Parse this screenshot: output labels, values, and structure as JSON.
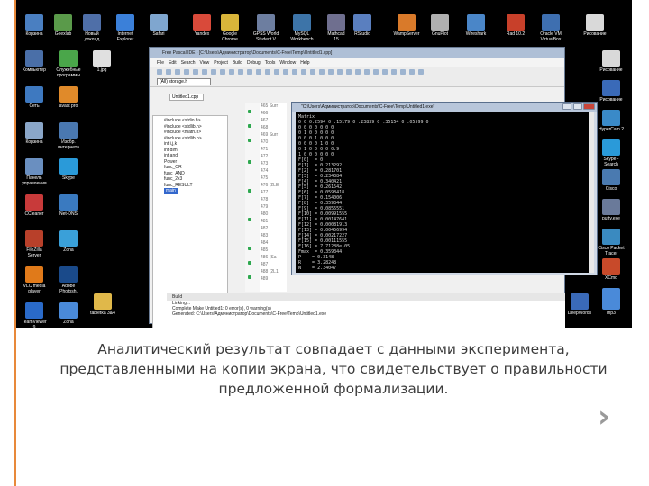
{
  "desktop": {
    "icons_top_row": [
      {
        "label": "Корзина",
        "color": "#4a7fc1"
      },
      {
        "label": "Geexlab",
        "color": "#5a9a4a"
      },
      {
        "label": "Новый\nдоклад",
        "color": "#4f6fa8"
      },
      {
        "label": "Internet\nExplorer",
        "color": "#3b80d9"
      },
      {
        "label": "Safari",
        "color": "#7fa6cf"
      },
      {
        "label": "Yandex",
        "color": "#d94a3a"
      },
      {
        "label": "Google\nChrome",
        "color": "#d9b53a"
      },
      {
        "label": "GPSS World\nStudent V",
        "color": "#6d7ea0"
      },
      {
        "label": "MySQL\nWorkbench",
        "color": "#3d74a8"
      },
      {
        "label": "Mathcad\n15",
        "color": "#6f6f8f"
      },
      {
        "label": "RStudio",
        "color": "#5a7fbf"
      },
      {
        "label": "WampServer",
        "color": "#d97a2a"
      },
      {
        "label": "GnuPlot",
        "color": "#b0b0b0"
      },
      {
        "label": "Wireshark",
        "color": "#4a86c8"
      },
      {
        "label": "Rad 10.2",
        "color": "#c8402a"
      },
      {
        "label": "Oracle VM\nVirtualBox",
        "color": "#3e6fb0"
      },
      {
        "label": "Рисование",
        "color": "#d9d9d9"
      }
    ],
    "icons_left_col": [
      {
        "label": "Компьютер",
        "color": "#4a6fa8"
      },
      {
        "label": "Сеть",
        "color": "#3e79c0"
      },
      {
        "label": "Корзина",
        "color": "#8aa6c8"
      },
      {
        "label": "Панель\nуправления",
        "color": "#6a8fc0"
      },
      {
        "label": "CCleaner",
        "color": "#c83a3a"
      },
      {
        "label": "FileZilla\nServer",
        "color": "#b8402a"
      },
      {
        "label": "VLC media\nplayer",
        "color": "#e07a1a"
      },
      {
        "label": "TeamViewer\n9",
        "color": "#2a6ac8"
      }
    ],
    "icons_second_col": [
      {
        "label": "Служебные\nпрограммы",
        "color": "#4aa64a"
      },
      {
        "label": "avast pro",
        "color": "#e08a2a"
      },
      {
        "label": "Изобр.\nинтернета",
        "color": "#4a78b0"
      },
      {
        "label": "Skype",
        "color": "#2a9ad9"
      },
      {
        "label": "Net-DNS",
        "color": "#3a7ac0"
      },
      {
        "label": "Zona",
        "color": "#3aa0d9"
      },
      {
        "label": "Adobe\nPhotosh.",
        "color": "#1a4a8a"
      },
      {
        "label": "Zona",
        "color": "#4a8ad9"
      }
    ],
    "icons_right_col": [
      {
        "label": "Рисование",
        "color": "#d9d9d9"
      },
      {
        "label": "Рисование",
        "color": "#3a6ab8"
      },
      {
        "label": "HyperCam 2",
        "color": "#3a8ac8"
      },
      {
        "label": "Skype -\nSearch",
        "color": "#2a9ad9"
      },
      {
        "label": "Cisco",
        "color": "#4a7ab0"
      },
      {
        "label": "putty.exe",
        "color": "#6a7a9a"
      },
      {
        "label": "Cisco Packet\nTracer",
        "color": "#3a8ac0"
      },
      {
        "label": "XCmd",
        "color": "#c84a2a"
      },
      {
        "label": "mp3",
        "color": "#4a8ad9"
      }
    ],
    "misc_labels": {
      "desktop_file": "1.jpg",
      "desktop_folder": "tabletka 3&4",
      "bottom_right_a": "DeepWords",
      "bottom_right_b": "mp3"
    }
  },
  "editor": {
    "title": "Free Pascal IDE - [C:\\Users\\Администратор\\Documents\\C-Free\\Temp\\Untitled1.cpp]",
    "menu": [
      "File",
      "Edit",
      "Search",
      "View",
      "Project",
      "Build",
      "Debug",
      "Tools",
      "Window",
      "Help"
    ],
    "combo_value": "(All) storage.h",
    "tab_label": "Untitled1.cpp",
    "tree": [
      "#include <stdio.h>",
      "#include <stdlib.h>",
      "#include <math.h>",
      "#include <stdlib.h>",
      "int i,j,k",
      "int dim",
      "int and",
      "Power",
      "func_OR",
      "func_AND",
      "func_2x3",
      "func_RESULT",
      "main"
    ],
    "line_numbers": [
      "465",
      "466",
      "467",
      "468",
      "469",
      "470",
      "471",
      "472",
      "473",
      "474",
      "475",
      "476",
      "477",
      "478",
      "479",
      "480",
      "481",
      "482",
      "483",
      "484",
      "485",
      "486",
      "487",
      "488",
      "489"
    ],
    "code_fragments": [
      "Surr",
      "",
      "",
      "",
      "Surr",
      "",
      "",
      "",
      "",
      "",
      "",
      "(2LE",
      "",
      "",
      "",
      "",
      "",
      "",
      "",
      "",
      "",
      "(Sa",
      "",
      "(2L1",
      "",
      "(2L1"
    ]
  },
  "console": {
    "title": "\"C:\\Users\\Администратор\\Documents\\C-Free\\Temp\\Untitled1.exe\"",
    "lines": [
      "Matrix",
      "0 0 0.2594 0 .15179 0 .23839 0 .35154 0 .05599 0",
      "0 0 0 0 0 0 0",
      "0 1 0 0 0 0 0",
      "0 0 0 1 0 0 0",
      "0 0 0 0 1 0 0",
      "0 1 0 0 0 0 0.9",
      "1 0 0 0 0 0 0",
      "",
      "F[0]  = 0",
      "F[1]  = 0.213292",
      "F[2]  = 0.281701",
      "F[3]  = 0.234384",
      "F[4]  = 0.340421",
      "F[5]  = 0.261542",
      "F[6]  = 0.0598418",
      "F[7]  = 0.154006",
      "F[8]  = 0.359344",
      "F[9]  = 0.0855551",
      "F[10] = 0.00991555",
      "F[11] = 0.00147641",
      "F[12] = 0.00081913",
      "F[13] = 0.00456994",
      "F[14] = 0.00217227",
      "F[15] = 0.00111555",
      "F[16] = 7.71288e-05",
      "",
      "Fmax  = 0.359344",
      "P    = 0.3148",
      "R    = 3.28248",
      "N    = 2.34047"
    ]
  },
  "log": {
    "header": "Build",
    "lines": [
      "Linking...",
      "",
      "Complete Make Untitled1: 0 error(s), 0 warning(s)",
      "Generated: C:\\Users\\Администратор\\Documents\\C-Free\\Temp\\Untitled1.exe"
    ]
  },
  "caption": {
    "line1": "Аналитический результат совпадает с данными эксперимента,",
    "line2": "представленными на копии экрана, что свидетельствует о правильности",
    "line3": "предложенной формализации."
  },
  "nav": {
    "next_glyph": "›"
  },
  "colors": {
    "accent_line": "#e8893a",
    "caption_text": "#3d3d3d",
    "arrow": "#9a9a9a"
  }
}
